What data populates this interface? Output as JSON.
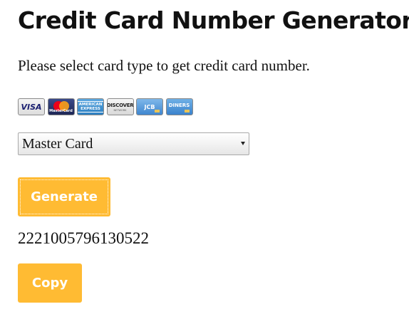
{
  "page": {
    "title": "Credit Card Number Generator",
    "instruction": "Please select card type to get credit card number."
  },
  "card_logos": [
    {
      "name": "visa",
      "label": "VISA"
    },
    {
      "name": "mastercard",
      "label": "MasterCard"
    },
    {
      "name": "american-express",
      "label": "AMERICAN EXPRESS"
    },
    {
      "name": "discover",
      "label": "DISCOVER",
      "sub": "NETWORK"
    },
    {
      "name": "jcb",
      "label": "JCB"
    },
    {
      "name": "diners",
      "label": "DINERS"
    }
  ],
  "card_select": {
    "selected": "Master Card"
  },
  "generate_button": {
    "label": "Generate"
  },
  "result": {
    "card_number": "2221005796130522"
  },
  "copy_button": {
    "label": "Copy"
  },
  "colors": {
    "button_bg": "#ffbb33",
    "button_text": "#ffffff",
    "text": "#111111"
  }
}
